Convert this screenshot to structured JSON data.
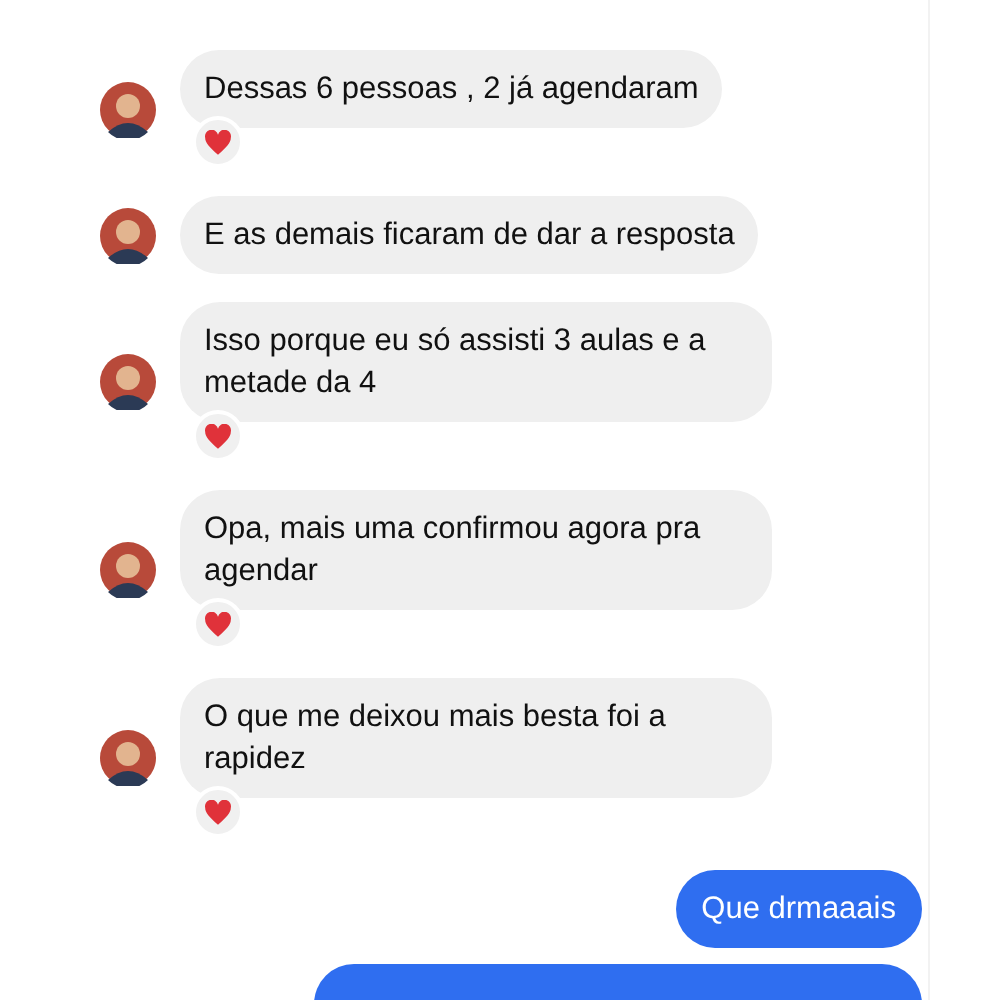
{
  "messages": [
    {
      "kind": "received",
      "text": "Dessas 6 pessoas , 2 já agendaram",
      "reaction": true
    },
    {
      "kind": "received",
      "text": "E as demais ficaram de dar a resposta",
      "reaction": false
    },
    {
      "kind": "received",
      "text": "Isso porque eu só assisti 3 aulas e a metade da 4",
      "reaction": true
    },
    {
      "kind": "received",
      "text": "Opa, mais uma confirmou agora pra agendar",
      "reaction": true
    },
    {
      "kind": "received",
      "text": "O que me deixou mais besta foi a rapidez",
      "reaction": true
    },
    {
      "kind": "sent",
      "text": "Que drmaaais",
      "reaction": false
    },
    {
      "kind": "sent_cut"
    }
  ]
}
